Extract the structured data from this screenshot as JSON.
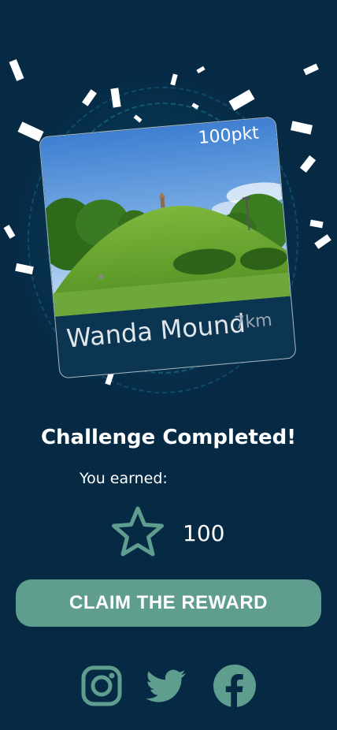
{
  "card": {
    "points": "100pkt",
    "name": "Wanda Mound",
    "distance": "7km"
  },
  "completion": {
    "title": "Challenge Completed!",
    "earned_label": "You earned:",
    "reward_value": "100"
  },
  "actions": {
    "claim_label": "CLAIM THE REWARD"
  },
  "social": [
    "instagram-icon",
    "twitter-icon",
    "facebook-icon"
  ],
  "colors": {
    "background": "#062944",
    "accent": "#5f9e8e",
    "text": "#ffffff"
  }
}
